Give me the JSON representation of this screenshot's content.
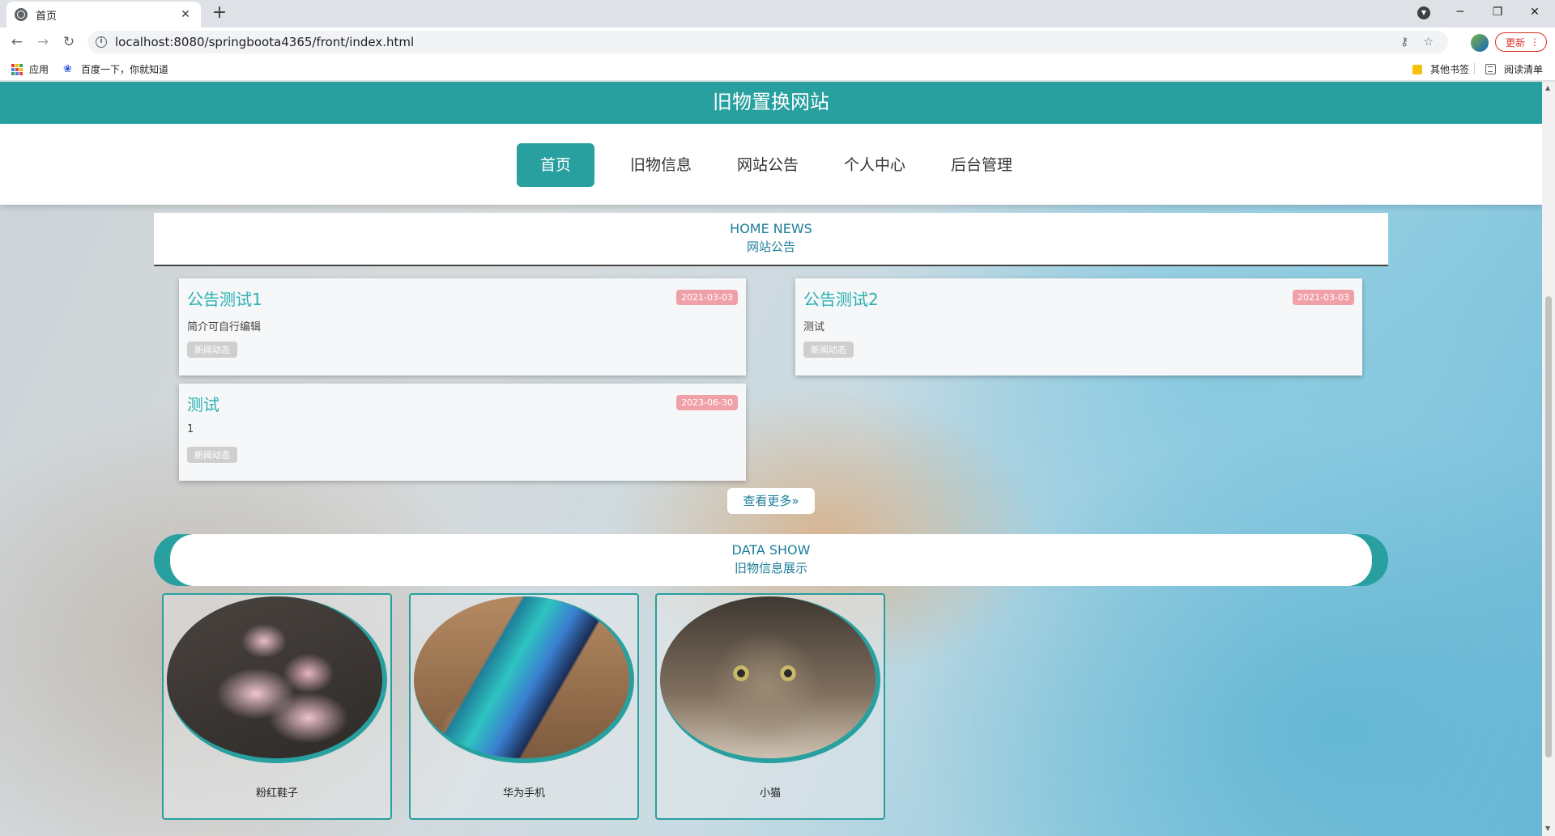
{
  "browser": {
    "tab_title": "首页",
    "tab_close": "✕",
    "new_tab": "+",
    "url": "localhost:8080/springboota4365/front/index.html",
    "update_label": "更新",
    "bookmarks": {
      "apps": "应用",
      "baidu": "百度一下，你就知道",
      "other": "其他书签",
      "reading_list": "阅读清单"
    }
  },
  "site": {
    "title": "旧物置换网站",
    "nav": [
      {
        "label": "首页"
      },
      {
        "label": "旧物信息"
      },
      {
        "label": "网站公告"
      },
      {
        "label": "个人中心"
      },
      {
        "label": "后台管理"
      }
    ],
    "news_section": {
      "en": "HOME NEWS",
      "cn": "网站公告"
    },
    "news": [
      {
        "title": "公告测试1",
        "date": "2021-03-03",
        "desc": "简介可自行编辑",
        "tag": "新闻动态"
      },
      {
        "title": "公告测试2",
        "date": "2021-03-03",
        "desc": "测试",
        "tag": "新闻动态"
      },
      {
        "title": "测试",
        "date": "2023-06-30",
        "desc": "1",
        "tag": "新闻动态"
      }
    ],
    "more_label": "查看更多»",
    "data_section": {
      "en": "DATA SHOW",
      "cn": "旧物信息展示"
    },
    "products": [
      {
        "name": "粉红鞋子"
      },
      {
        "name": "华为手机"
      },
      {
        "name": "小猫"
      }
    ]
  },
  "colors": {
    "brand": "#28a09f",
    "date_badge": "#f0a1a8",
    "link_title": "#2ab0b0"
  }
}
